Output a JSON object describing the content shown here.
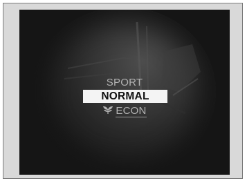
{
  "drive_mode_menu": {
    "items": [
      {
        "label": "SPORT",
        "selected": false
      },
      {
        "label": "NORMAL",
        "selected": true
      },
      {
        "label": "ECON",
        "selected": false,
        "icon": "leaf-icon"
      }
    ]
  },
  "colors": {
    "screen_background": "#151515",
    "selection_highlight": "#f4f4f4",
    "unselected_text": "#b3b3b3",
    "frame_background": "#d9d9d9"
  }
}
